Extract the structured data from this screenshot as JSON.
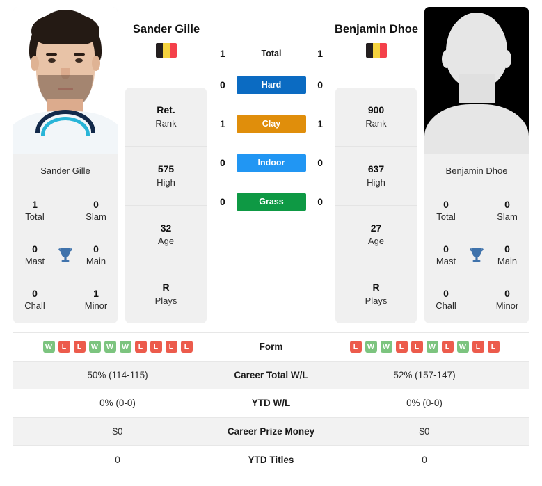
{
  "players": {
    "left": {
      "name": "Sander Gille",
      "photo_name": "Sander Gille",
      "flag": "belgium-flag",
      "rank": {
        "value": "Ret.",
        "label": "Rank"
      },
      "high": {
        "value": "575",
        "label": "High"
      },
      "age": {
        "value": "32",
        "label": "Age"
      },
      "plays": {
        "value": "R",
        "label": "Plays"
      },
      "titles": {
        "total": {
          "value": "1",
          "label": "Total"
        },
        "slam": {
          "value": "0",
          "label": "Slam"
        },
        "mast": {
          "value": "0",
          "label": "Mast"
        },
        "main": {
          "value": "0",
          "label": "Main"
        },
        "chall": {
          "value": "0",
          "label": "Chall"
        },
        "minor": {
          "value": "1",
          "label": "Minor"
        }
      },
      "form": [
        "W",
        "L",
        "L",
        "W",
        "W",
        "W",
        "L",
        "L",
        "L",
        "L"
      ],
      "career_total_wl": "50% (114-115)",
      "ytd_wl": "0% (0-0)",
      "career_prize_money": "$0",
      "ytd_titles": "0"
    },
    "right": {
      "name": "Benjamin Dhoe",
      "photo_name": "Benjamin Dhoe",
      "flag": "belgium-flag",
      "rank": {
        "value": "900",
        "label": "Rank"
      },
      "high": {
        "value": "637",
        "label": "High"
      },
      "age": {
        "value": "27",
        "label": "Age"
      },
      "plays": {
        "value": "R",
        "label": "Plays"
      },
      "titles": {
        "total": {
          "value": "0",
          "label": "Total"
        },
        "slam": {
          "value": "0",
          "label": "Slam"
        },
        "mast": {
          "value": "0",
          "label": "Mast"
        },
        "main": {
          "value": "0",
          "label": "Main"
        },
        "chall": {
          "value": "0",
          "label": "Chall"
        },
        "minor": {
          "value": "0",
          "label": "Minor"
        }
      },
      "form": [
        "L",
        "W",
        "W",
        "L",
        "L",
        "W",
        "L",
        "W",
        "L",
        "L"
      ],
      "career_total_wl": "52% (157-147)",
      "ytd_wl": "0% (0-0)",
      "career_prize_money": "$0",
      "ytd_titles": "0"
    }
  },
  "h2h": {
    "total": {
      "label": "Total",
      "left": "1",
      "right": "1"
    },
    "surfaces": [
      {
        "label": "Hard",
        "left": "0",
        "right": "0",
        "color": "#0b6bc2"
      },
      {
        "label": "Clay",
        "left": "1",
        "right": "1",
        "color": "#e08e0b"
      },
      {
        "label": "Indoor",
        "left": "0",
        "right": "0",
        "color": "#2196f3"
      },
      {
        "label": "Grass",
        "left": "0",
        "right": "0",
        "color": "#0e9944"
      }
    ]
  },
  "stats_rows": {
    "form": "Form",
    "career_total_wl": "Career Total W/L",
    "ytd_wl": "YTD W/L",
    "career_prize_money": "Career Prize Money",
    "ytd_titles": "YTD Titles"
  },
  "colors": {
    "win": "#7cc47f",
    "loss": "#ec5b4c",
    "trophy": "#3f72ab",
    "panel": "#f0f0f0"
  }
}
